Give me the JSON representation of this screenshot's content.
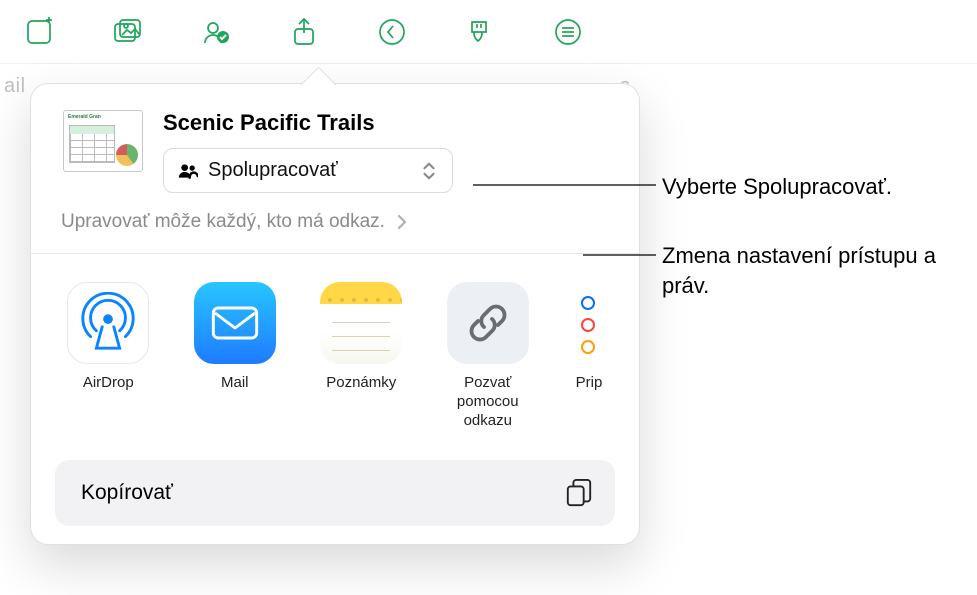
{
  "bg_hints": {
    "left": "ail",
    "right": "s"
  },
  "document": {
    "title": "Scenic Pacific Trails",
    "thumb_label": "Emerald Gran"
  },
  "collaborate": {
    "label": "Spolupracovať"
  },
  "access": {
    "text": "Upravovať môže každý, kto má odkaz."
  },
  "apps": {
    "airdrop": "AirDrop",
    "mail": "Mail",
    "notes": "Poznámky",
    "invite": "Pozvať pomocou odkazu",
    "reminders": "Prip"
  },
  "copy": {
    "label": "Kopírovať"
  },
  "callouts": {
    "c1": "Vyberte Spolupracovať.",
    "c2": "Zmena nastavení prístupu a práv."
  }
}
